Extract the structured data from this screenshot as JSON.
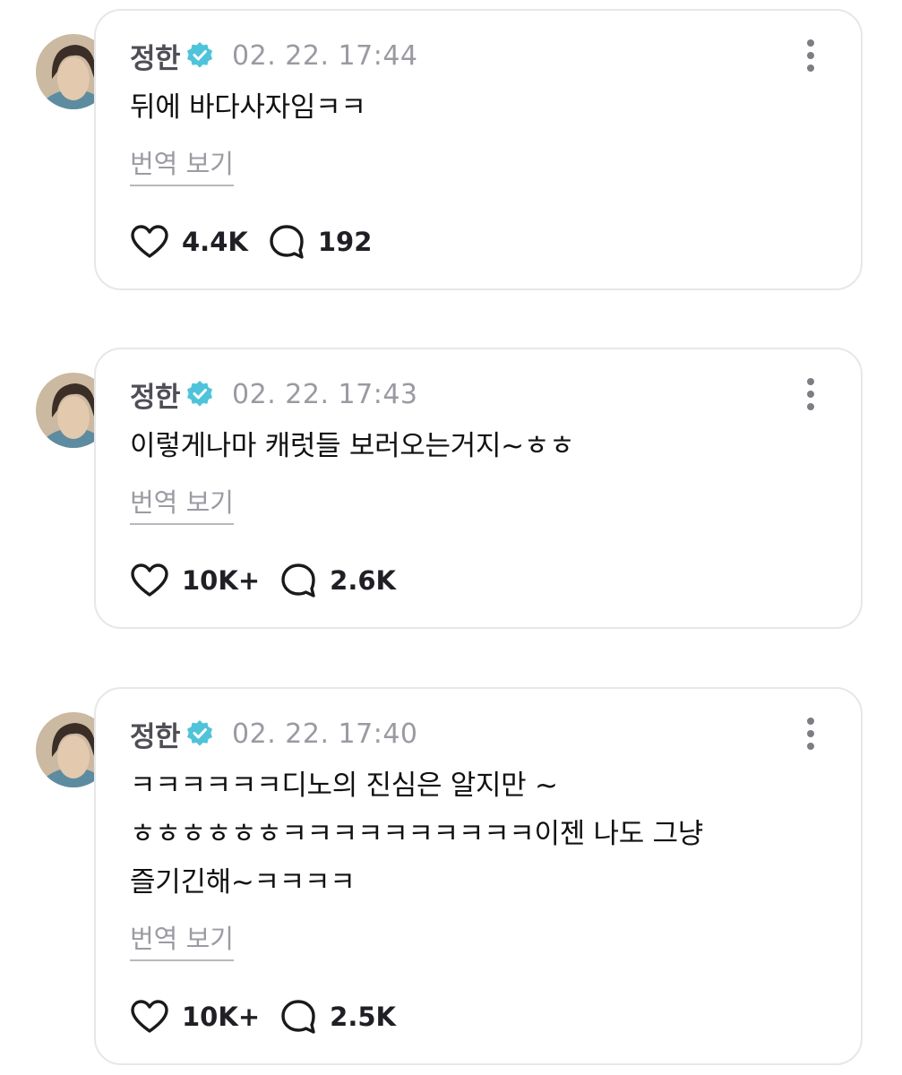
{
  "posts": [
    {
      "author": "정한",
      "timestamp": "02. 22. 17:44",
      "text": "뒤에 바다사자임ㅋㅋ",
      "translate_label": "번역 보기",
      "likes": "4.4K",
      "comments": "192"
    },
    {
      "author": "정한",
      "timestamp": "02. 22. 17:43",
      "text": "이렇게나마 캐럿들 보러오는거지~ㅎㅎ",
      "translate_label": "번역 보기",
      "likes": "10K+",
      "comments": "2.6K"
    },
    {
      "author": "정한",
      "timestamp": "02. 22. 17:40",
      "text": "ㅋㅋㅋㅋㅋㅋ디노의 진심은 알지만 ~\nㅎㅎㅎㅎㅎㅎㅋㅋㅋㅋㅋㅋㅋㅋㅋㅋ이젠 나도 그냥\n즐기긴해~ㅋㅋㅋㅋ",
      "translate_label": "번역 보기",
      "likes": "10K+",
      "comments": "2.5K"
    }
  ],
  "icons": {
    "verified": "verified-badge-icon",
    "more": "more-vertical-icon",
    "like": "heart-outline-icon",
    "comment": "comment-bubble-icon"
  },
  "colors": {
    "verified_badge": "#4fc3d9",
    "author": "#4e4e56",
    "timestamp": "#9a9aa2",
    "card_border": "#e7e7ea"
  }
}
